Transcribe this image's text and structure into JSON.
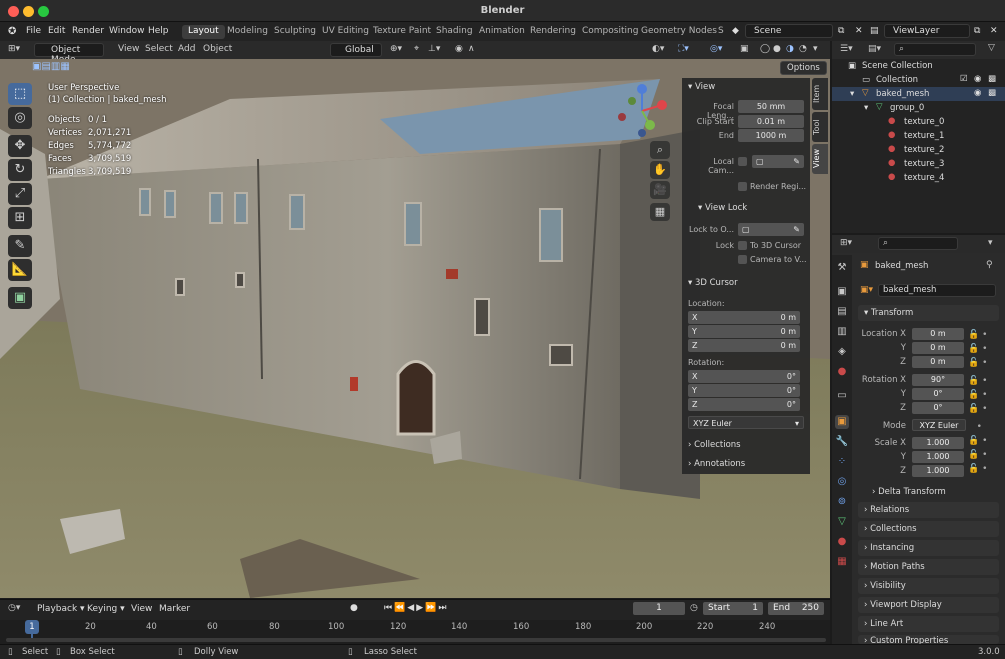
{
  "window": {
    "title": "Blender"
  },
  "menu": {
    "items": [
      "File",
      "Edit",
      "Render",
      "Window",
      "Help"
    ]
  },
  "workspaces": [
    "Layout",
    "Modeling",
    "Sculpting",
    "UV Editing",
    "Texture Paint",
    "Shading",
    "Animation",
    "Rendering",
    "Compositing",
    "Geometry Nodes",
    "S"
  ],
  "scene": {
    "name": "Scene",
    "view_layer": "ViewLayer"
  },
  "viewport_header": {
    "mode": "Object Mode",
    "menus": [
      "View",
      "Select",
      "Add",
      "Object"
    ],
    "transform": "Global",
    "options": "Options"
  },
  "overlay": {
    "perspective": "User Perspective",
    "collection": "(1) Collection | baked_mesh",
    "stats": [
      {
        "label": "Objects",
        "value": "0 / 1"
      },
      {
        "label": "Vertices",
        "value": "2,071,271"
      },
      {
        "label": "Edges",
        "value": "5,774,772"
      },
      {
        "label": "Faces",
        "value": "3,709,519"
      },
      {
        "label": "Triangles",
        "value": "3,709,519"
      }
    ]
  },
  "npanel": {
    "tabs": [
      "Item",
      "Tool",
      "View"
    ],
    "view": {
      "title": "View",
      "focal_label": "Focal Leng...",
      "focal_value": "50 mm",
      "clip_start_label": "Clip Start",
      "clip_start_value": "0.01 m",
      "end_label": "End",
      "end_value": "1000 m",
      "local_cam_label": "Local Cam...",
      "render_region_label": "Render Regi..."
    },
    "view_lock": {
      "title": "View Lock",
      "lock_to_label": "Lock to O...",
      "lock_label": "Lock",
      "to_cursor": "To 3D Cursor",
      "camera_to_view": "Camera to V..."
    },
    "cursor": {
      "title": "3D Cursor",
      "location_label": "Location:",
      "loc": [
        {
          "axis": "X",
          "value": "0 m"
        },
        {
          "axis": "Y",
          "value": "0 m"
        },
        {
          "axis": "Z",
          "value": "0 m"
        }
      ],
      "rotation_label": "Rotation:",
      "rot": [
        {
          "axis": "X",
          "value": "0°"
        },
        {
          "axis": "Y",
          "value": "0°"
        },
        {
          "axis": "Z",
          "value": "0°"
        }
      ],
      "mode": "XYZ Euler"
    },
    "collections": "Collections",
    "annotations": "Annotations"
  },
  "outliner": {
    "rows": [
      {
        "label": "Scene Collection"
      },
      {
        "label": "Collection"
      },
      {
        "label": "baked_mesh"
      },
      {
        "label": "group_0"
      },
      {
        "label": "texture_0"
      },
      {
        "label": "texture_1"
      },
      {
        "label": "texture_2"
      },
      {
        "label": "texture_3"
      },
      {
        "label": "texture_4"
      }
    ]
  },
  "properties": {
    "object_name": "baked_mesh",
    "data_name": "baked_mesh",
    "transform_title": "Transform",
    "location_label": "Location X",
    "loc": [
      "0 m",
      "0 m",
      "0 m"
    ],
    "rotation_label": "Rotation X",
    "rot": [
      "90°",
      "0°",
      "0°"
    ],
    "mode_label": "Mode",
    "mode_value": "XYZ Euler",
    "scale_label": "Scale X",
    "scale": [
      "1.000",
      "1.000",
      "1.000"
    ],
    "y_label": "Y",
    "z_label": "Z",
    "sections": [
      "Delta Transform",
      "Relations",
      "Collections",
      "Instancing",
      "Motion Paths",
      "Visibility",
      "Viewport Display",
      "Line Art",
      "Custom Properties"
    ]
  },
  "timeline": {
    "menus": [
      "Playback",
      "Keying",
      "View",
      "Marker"
    ],
    "current": "1",
    "start_label": "Start",
    "start": "1",
    "end_label": "End",
    "end": "250",
    "current_marker": "1",
    "ticks": [
      "20",
      "40",
      "60",
      "80",
      "100",
      "120",
      "140",
      "160",
      "180",
      "200",
      "220",
      "240"
    ]
  },
  "status": {
    "select": "Select",
    "box_select": "Box Select",
    "dolly": "Dolly View",
    "lasso": "Lasso Select",
    "version": "3.0.0"
  },
  "colors": {
    "accent": "#466a9c",
    "object_orange": "#e89a3c",
    "mesh_green": "#5ec47a",
    "material_red": "#c94a4a"
  }
}
